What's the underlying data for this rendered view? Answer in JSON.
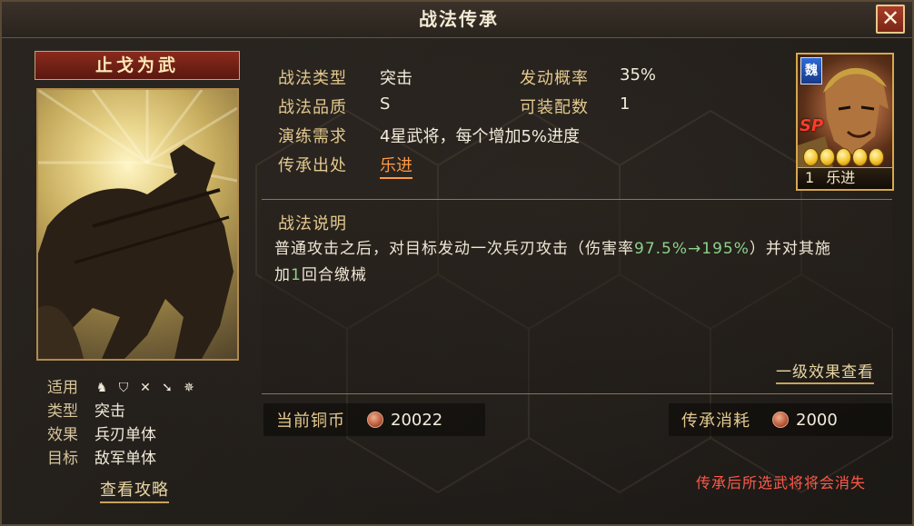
{
  "window": {
    "title": "战法传承",
    "close_label": "✕"
  },
  "skill_card": {
    "name": "止戈为武",
    "meta": {
      "apply_label": "适用",
      "apply_icons": [
        "cavalry-icon",
        "shield-icon",
        "bow-icon",
        "spear-icon",
        "wheel-icon"
      ],
      "type_label": "类型",
      "type_value": "突击",
      "effect_label": "效果",
      "effect_value": "兵刃单体",
      "target_label": "目标",
      "target_value": "敌军单体"
    },
    "strategy_link": "查看攻略"
  },
  "info": {
    "type_label": "战法类型",
    "type_value": "突击",
    "quality_label": "战法品质",
    "quality_value": "S",
    "practice_label": "演练需求",
    "practice_value": "4星武将，每个增加5%进度",
    "source_label": "传承出处",
    "source_value": "乐进",
    "trigger_label": "发动概率",
    "trigger_value": "35%",
    "equip_label": "可装配数",
    "equip_value": "1"
  },
  "general": {
    "faction": "魏",
    "sp": "SP",
    "stars": 5,
    "level": "1",
    "name": "乐进"
  },
  "description": {
    "title": "战法说明",
    "line1_a": "普通攻击之后，对目标发动一次兵刃攻击（伤害率",
    "line1_hl": "97.5%→195%",
    "line1_b": "）并对其施",
    "line2_a": "加",
    "line2_hl": "1",
    "line2_b": "回合缴械",
    "level_link": "一级效果查看"
  },
  "currency": {
    "current_label": "当前铜币",
    "current_value": "20022",
    "cost_label": "传承消耗",
    "cost_value": "2000"
  },
  "warning": "传承后所选武将将会消失"
}
